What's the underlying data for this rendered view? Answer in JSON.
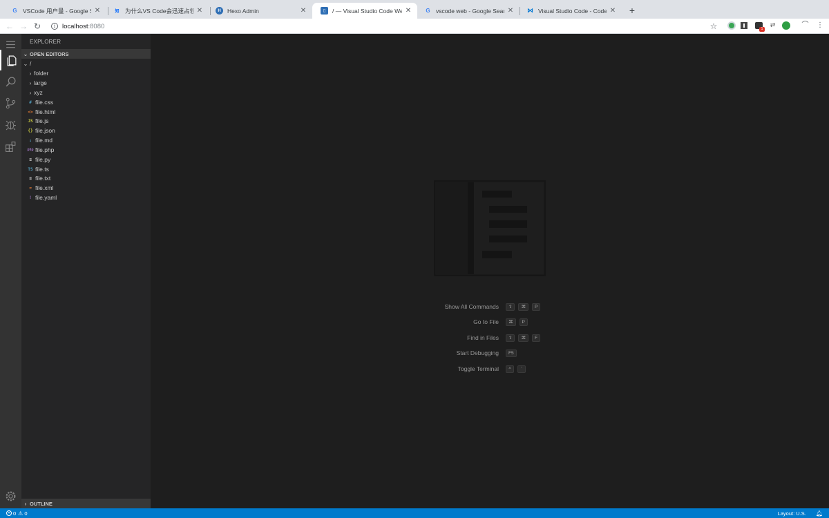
{
  "browser": {
    "tabs": [
      {
        "title": "VSCode 用户量 - Google Search",
        "favicon": "google-icon"
      },
      {
        "title": "为什么VS Code会迅速占领JavaScript",
        "favicon": "zhihu-icon"
      },
      {
        "title": "Hexo Admin",
        "favicon": "hexo-icon"
      },
      {
        "title": "/ — Visual Studio Code Web Dev",
        "favicon": "vscode-icon",
        "active": true
      },
      {
        "title": "vscode web - Google Search",
        "favicon": "google-icon"
      },
      {
        "title": "Visual Studio Code - Code Editing",
        "favicon": "vscode-icon"
      }
    ],
    "url_host": "localhost",
    "url_port": ":8080",
    "extension_badge": "1",
    "new_tab": "+"
  },
  "sidebar": {
    "title": "EXPLORER",
    "open_editors": "OPEN EDITORS",
    "root": "/",
    "folders": [
      "folder",
      "large",
      "xyz"
    ],
    "files": [
      {
        "name": "file.css",
        "icon": "#",
        "color": "#519aba"
      },
      {
        "name": "file.html",
        "icon": "<>",
        "color": "#e37933"
      },
      {
        "name": "file.js",
        "icon": "JS",
        "color": "#cbcb41"
      },
      {
        "name": "file.json",
        "icon": "{}",
        "color": "#cbcb41"
      },
      {
        "name": "file.md",
        "icon": "↓",
        "color": "#519aba"
      },
      {
        "name": "file.php",
        "icon": "php",
        "color": "#a074c4"
      },
      {
        "name": "file.py",
        "icon": "≡",
        "color": "#cccccc"
      },
      {
        "name": "file.ts",
        "icon": "TS",
        "color": "#519aba"
      },
      {
        "name": "file.txt",
        "icon": "≡",
        "color": "#cccccc"
      },
      {
        "name": "file.xml",
        "icon": "≈",
        "color": "#e37933"
      },
      {
        "name": "file.yaml",
        "icon": "!",
        "color": "#a074c4"
      }
    ],
    "outline": "OUTLINE"
  },
  "shortcuts": [
    {
      "label": "Show All Commands",
      "keys": [
        "⇧",
        "⌘",
        "P"
      ]
    },
    {
      "label": "Go to File",
      "keys": [
        "⌘",
        "P"
      ]
    },
    {
      "label": "Find in Files",
      "keys": [
        "⇧",
        "⌘",
        "F"
      ]
    },
    {
      "label": "Start Debugging",
      "keys": [
        "F5"
      ]
    },
    {
      "label": "Toggle Terminal",
      "keys": [
        "^",
        "`"
      ]
    }
  ],
  "status": {
    "errors": "0",
    "warnings": "0",
    "layout": "Layout: U.S."
  },
  "colors": {
    "accent": "#007acc",
    "sidebar_bg": "#252526",
    "editor_bg": "#1e1e1e",
    "activity_bg": "#333333"
  }
}
